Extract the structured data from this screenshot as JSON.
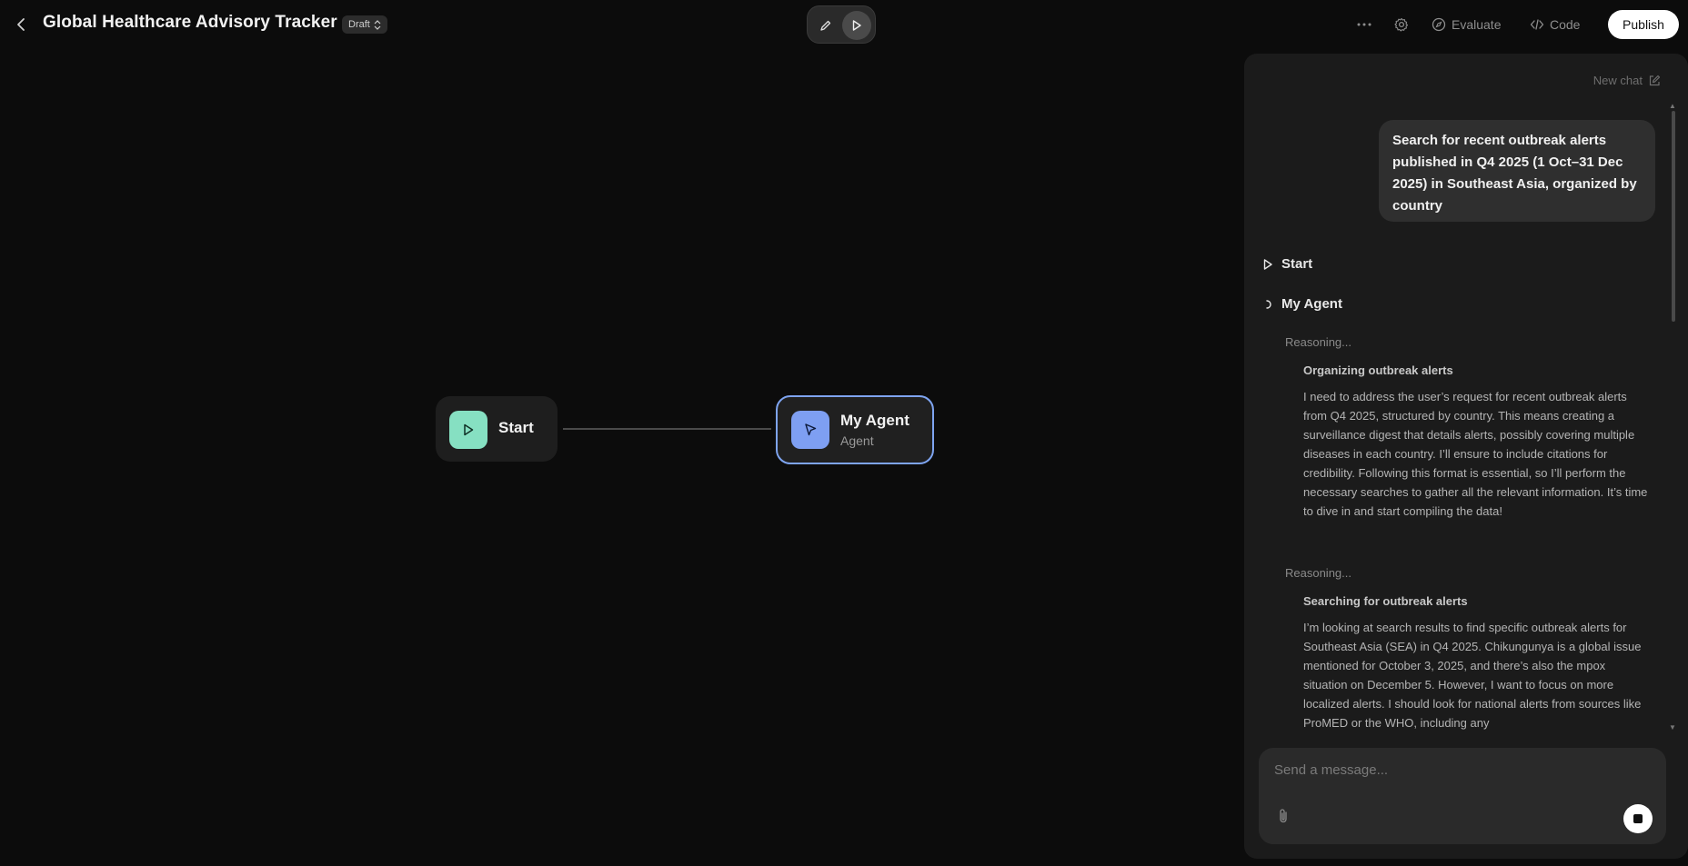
{
  "header": {
    "title": "Global Healthcare Advisory Tracker",
    "status": "Draft",
    "evaluate_label": "Evaluate",
    "code_label": "Code",
    "publish_label": "Publish"
  },
  "canvas": {
    "nodes": [
      {
        "title": "Start",
        "subtitle": ""
      },
      {
        "title": "My Agent",
        "subtitle": "Agent"
      }
    ]
  },
  "chat": {
    "new_chat_label": "New chat",
    "user_message": "Search for recent outbreak alerts published in Q4 2025 (1 Oct–31 Dec 2025) in Southeast Asia, organized by country",
    "steps": [
      "Start",
      "My Agent"
    ],
    "reasoning": [
      {
        "label": "Reasoning...",
        "title": "Organizing outbreak alerts",
        "body": "I need to address the user’s request for recent outbreak alerts from Q4 2025, structured by country. This means creating a surveillance digest that details alerts, possibly covering multiple diseases in each country. I’ll ensure to include citations for credibility. Following this format is essential, so I’ll perform the necessary searches to gather all the relevant information. It’s time to dive in and start compiling the data!"
      },
      {
        "label": "Reasoning...",
        "title": "Searching for outbreak alerts",
        "body": "I’m looking at search results to find specific outbreak alerts for Southeast Asia (SEA) in Q4 2025. Chikungunya is a global issue mentioned for October 3, 2025, and there’s also the mpox situation on December 5. However, I want to focus on more localized alerts. I should look for national alerts from sources like ProMED or the WHO, including any"
      }
    ],
    "composer_placeholder": "Send a message..."
  },
  "colors": {
    "start_node": "#86e0c2",
    "agent_node": "#7e9ff2",
    "agent_border": "#7ea4f0"
  }
}
